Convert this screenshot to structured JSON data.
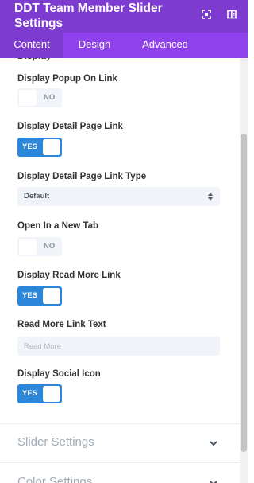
{
  "header": {
    "title": "DDT Team Member Slider Settings",
    "expand_icon": "expand-icon",
    "sidebar_icon": "sidebar-layout-icon",
    "background_color": "#7e3bd0"
  },
  "tabs": [
    {
      "label": "Content",
      "active": true
    },
    {
      "label": "Design",
      "active": false
    },
    {
      "label": "Advanced",
      "active": false
    }
  ],
  "fields": {
    "popup_link": {
      "label": "Display Popup On Link",
      "state": "NO"
    },
    "detail_page_link": {
      "label": "Display Detail Page Link",
      "state": "YES"
    },
    "detail_page_link_type": {
      "label": "Display Detail Page Link Type",
      "value": "Default"
    },
    "new_tab": {
      "label": "Open In a New Tab",
      "state": "NO"
    },
    "read_more_link": {
      "label": "Display Read More Link",
      "state": "YES"
    },
    "read_more_text": {
      "label": "Read More Link Text",
      "placeholder": "Read More"
    },
    "social_icon": {
      "label": "Display Social Icon",
      "state": "YES"
    }
  },
  "sections": [
    {
      "title": "Slider Settings"
    },
    {
      "title": "Color Settings"
    }
  ],
  "colors": {
    "toggle_on": "#2b87da",
    "toggle_off": "#f1f5f9",
    "tab_bar": "#8f42ec"
  }
}
